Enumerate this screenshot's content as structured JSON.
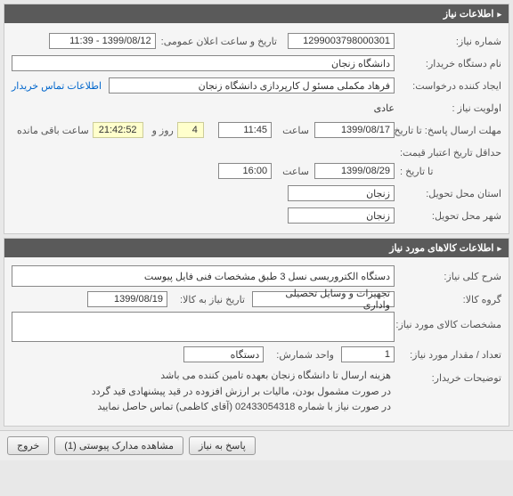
{
  "panels": {
    "need_info_header": "اطلاعات نیاز",
    "goods_info_header": "اطلاعات کالاهای مورد نیاز"
  },
  "labels": {
    "need_number": "شماره نیاز:",
    "announce_datetime": "تاریخ و ساعت اعلان عمومی:",
    "buyer_org": "نام دستگاه خریدار:",
    "request_creator": "ایجاد کننده درخواست:",
    "need_priority": "اولویت نیاز :",
    "response_deadline": "مهلت ارسال پاسخ:  تا تاریخ :",
    "time": "ساعت",
    "day_and": "روز و",
    "remaining": "ساعت باقی مانده",
    "min_validity": "حداقل تاریخ اعتبار قیمت:",
    "until_date": "تا تاریخ :",
    "delivery_province": "استان محل تحویل:",
    "delivery_city": "شهر محل تحویل:",
    "general_desc": "شرح کلی نیاز:",
    "goods_group": "گروه کالا:",
    "need_date_to_goods": "تاریخ نیاز به کالا:",
    "goods_specs": "مشخصات کالای مورد نیاز:",
    "qty_needed": "تعداد / مقدار مورد نیاز:",
    "count_unit": "واحد شمارش:",
    "buyer_notes": "توضیحات خریدار:"
  },
  "values": {
    "need_number": "1299003798000301",
    "announce_datetime": "1399/08/12 - 11:39",
    "buyer_org": "دانشگاه زنجان",
    "request_creator": "فرهاد مکملی مسئو ل کارپردازی دانشگاه زنجان",
    "need_priority": "عادی",
    "deadline_date": "1399/08/17",
    "deadline_time": "11:45",
    "days_remaining": "4",
    "time_remaining": "21:42:52",
    "validity_date": "1399/08/29",
    "validity_time": "16:00",
    "delivery_province": "زنجان",
    "delivery_city": "زنجان",
    "general_desc": "دستگاه الکتروریسی نسل 3 طبق مشخصات فنی فایل پیوست",
    "goods_group": "تجهیزات و وسایل تحصیلی واداری",
    "need_date_to_goods": "1399/08/19",
    "goods_specs": "",
    "qty": "1",
    "unit": "دستگاه",
    "buyer_notes_l1": "هزینه ارسال تا دانشگاه زنجان بعهده تامین کننده می باشد",
    "buyer_notes_l2": "در صورت مشمول بودن، مالیات بر ارزش افزوده در قید پیشنهادی قید گردد",
    "buyer_notes_l3": "در صورت نیاز با شماره 02433054318 (آقای کاظمی) تماس حاصل نمایید"
  },
  "links": {
    "buyer_contact": "اطلاعات تماس خریدار"
  },
  "buttons": {
    "respond": "پاسخ به نیاز",
    "attachments": "مشاهده مدارک پیوستی (1)",
    "exit": "خروج"
  }
}
